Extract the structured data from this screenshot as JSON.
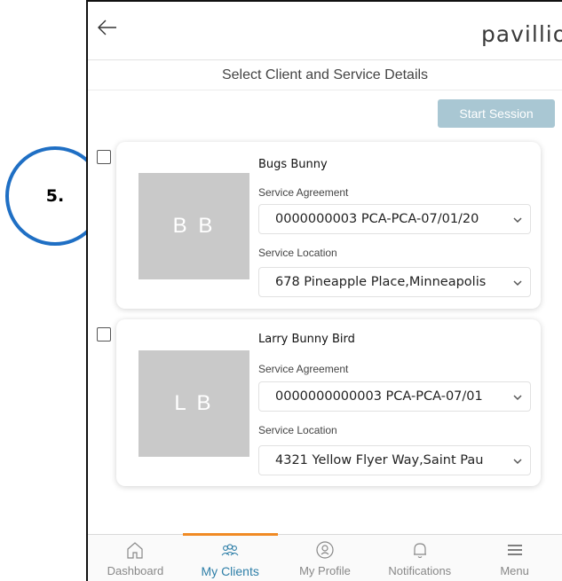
{
  "annotation": {
    "step": "5."
  },
  "header": {
    "logo_text": "pavillio",
    "back": "back-arrow"
  },
  "page_title": "Select Client and Service Details",
  "actions": {
    "start_session": "Start Session"
  },
  "clients": [
    {
      "name": "Bugs Bunny",
      "initials": "B B",
      "agreement_label": "Service Agreement",
      "agreement_value": "0000000003 PCA-PCA-07/01/20",
      "location_label": "Service Location",
      "location_value": "678 Pineapple Place,Minneapolis"
    },
    {
      "name": "Larry Bunny Bird",
      "initials": "L B",
      "agreement_label": "Service Agreement",
      "agreement_value": "0000000000003 PCA-PCA-07/01",
      "location_label": "Service Location",
      "location_value": "4321 Yellow Flyer Way,Saint Pau"
    }
  ],
  "nav": {
    "items": [
      {
        "label": "Dashboard",
        "icon": "home-icon"
      },
      {
        "label": "My Clients",
        "icon": "clients-icon"
      },
      {
        "label": "My Profile",
        "icon": "profile-icon"
      },
      {
        "label": "Notifications",
        "icon": "bell-icon"
      },
      {
        "label": "Menu",
        "icon": "menu-icon"
      }
    ],
    "active": "My Clients"
  },
  "colors": {
    "accent": "#f08a24",
    "active_nav": "#2f7fa8",
    "button_disabled": "#a9c7d3",
    "avatar_bg": "#c9c9c9",
    "callout": "#1f6fc4"
  }
}
